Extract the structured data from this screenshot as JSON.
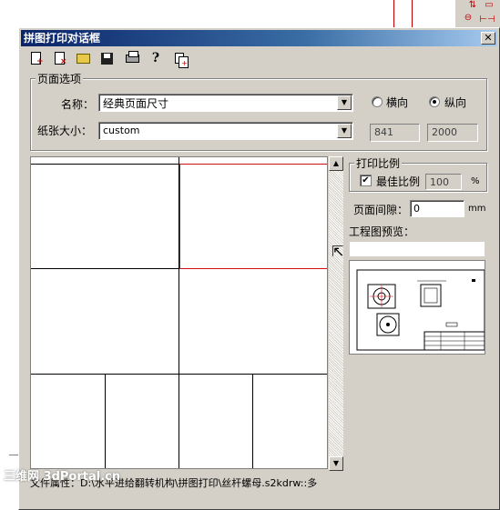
{
  "window": {
    "title": "拼图打印对话框",
    "close_label": "✕"
  },
  "toolbar": {
    "buttons": [
      {
        "name": "new-icon",
        "mark": "+"
      },
      {
        "name": "delete-icon",
        "mark": "×"
      },
      {
        "name": "open-folder-icon",
        "mark": ""
      },
      {
        "name": "save-icon",
        "mark": ""
      },
      {
        "name": "print-icon",
        "mark": ""
      },
      {
        "name": "help-icon",
        "mark": "?"
      },
      {
        "name": "copy-icon",
        "mark": "+"
      }
    ]
  },
  "page_options": {
    "group_label": "页面选项",
    "name_label": "名称：",
    "name_value": "经典页面尺寸",
    "paper_size_label": "纸张大小：",
    "paper_size_value": "custom",
    "orientation_landscape": "横向",
    "orientation_portrait": "纵向",
    "selected_orientation": "portrait",
    "width_value": "841",
    "height_value": "2000"
  },
  "print_scale": {
    "group_label": "打印比例",
    "best_scale_label": "最佳比例",
    "best_scale_checked": true,
    "scale_value": "100",
    "scale_unit": "%"
  },
  "page_gap": {
    "label": "页面间隙：",
    "value": "0",
    "unit": "mm"
  },
  "preview": {
    "label": "工程图预览："
  },
  "status": {
    "label": "文件属性：",
    "path": "D:\\水平进给翻转机构\\拼图打印\\丝杆螺母.s2kdrw::多"
  },
  "watermark": "三维网 3dPortal.cn",
  "icons": {
    "scroll_up": "▲",
    "scroll_down": "▼",
    "dropdown": "▼",
    "cursor": "⇱"
  }
}
